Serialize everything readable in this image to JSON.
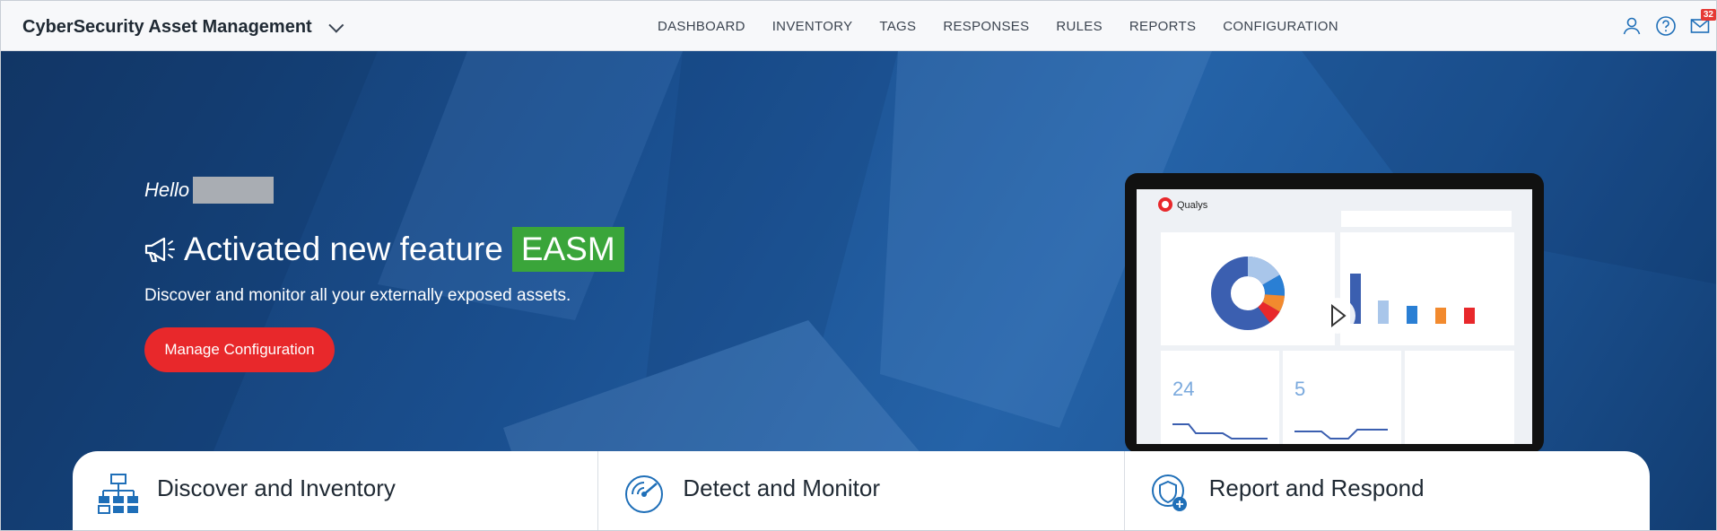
{
  "app": {
    "title": "CyberSecurity Asset Management"
  },
  "nav": {
    "items": [
      "DASHBOARD",
      "INVENTORY",
      "TAGS",
      "RESPONSES",
      "RULES",
      "REPORTS",
      "CONFIGURATION"
    ]
  },
  "header_icons": {
    "notification_count": "32"
  },
  "hero": {
    "greeting": "Hello",
    "headline": "Activated new feature",
    "badge": "EASM",
    "subtitle": "Discover and monitor all your externally exposed assets.",
    "button_label": "Manage Configuration"
  },
  "laptop_preview": {
    "brand": "Qualys",
    "stat1": "24",
    "stat2": "5"
  },
  "cards": [
    {
      "title": "Discover and Inventory"
    },
    {
      "title": "Detect and Monitor"
    },
    {
      "title": "Report and Respond"
    }
  ],
  "colors": {
    "accent_red": "#e8282b",
    "badge_green": "#3aa53a",
    "hero_blue": "#1a4f8f"
  }
}
